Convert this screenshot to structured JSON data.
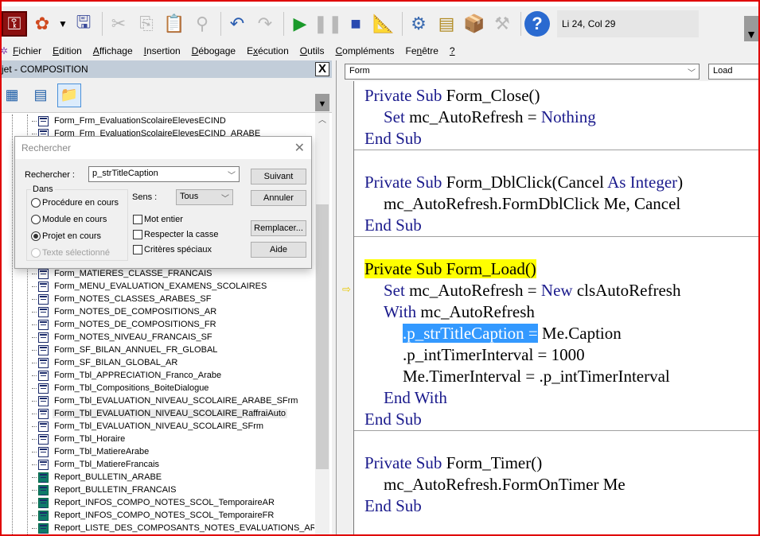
{
  "toolbar": {
    "status": "Li 24, Col 29",
    "icons": [
      "access-key-icon",
      "insert-object-icon",
      "dropdown-icon",
      "save-icon",
      "cut-icon",
      "copy-icon",
      "paste-icon",
      "find-icon",
      "undo-icon",
      "redo-icon",
      "run-icon",
      "pause-icon",
      "reset-icon",
      "design-mode-icon",
      "project-explorer-icon",
      "properties-icon",
      "object-browser-icon",
      "toolbox-icon",
      "help-icon"
    ]
  },
  "menu": [
    {
      "label": "Fichier",
      "mn": "F",
      "rest": "ichier"
    },
    {
      "label": "Edition",
      "mn": "E",
      "rest": "dition"
    },
    {
      "label": "Affichage",
      "mn": "A",
      "rest": "ffichage"
    },
    {
      "label": "Insertion",
      "mn": "I",
      "rest": "nsertion"
    },
    {
      "label": "Débogage",
      "mn": "D",
      "rest": "ébogage"
    },
    {
      "label": "Exécution",
      "mn": "x",
      "pre": "E",
      "rest": "écution"
    },
    {
      "label": "Outils",
      "mn": "O",
      "rest": "utils"
    },
    {
      "label": "Compléments",
      "mn": "C",
      "rest": "ompléments"
    },
    {
      "label": "Fenêtre",
      "mn": "n",
      "pre": "Fe",
      "rest": "être"
    },
    {
      "label": "?",
      "mn": "?",
      "rest": ""
    }
  ],
  "project": {
    "title": "jet - COMPOSITION",
    "close": "X",
    "items_top": [
      "Form_Frm_EvaluationScolaireElevesECIND",
      "Form_Frm_EvaluationScolaireElevesECIND_ARABE"
    ],
    "items": [
      {
        "name": "Form_MATIERES_CLASSE_FRANCAIS",
        "type": "form"
      },
      {
        "name": "Form_MENU_EVALUATION_EXAMENS_SCOLAIRES",
        "type": "form"
      },
      {
        "name": "Form_NOTES_CLASSES_ARABES_SF",
        "type": "form"
      },
      {
        "name": "Form_NOTES_DE_COMPOSITIONS_AR",
        "type": "form"
      },
      {
        "name": "Form_NOTES_DE_COMPOSITIONS_FR",
        "type": "form"
      },
      {
        "name": "Form_NOTES_NIVEAU_FRANCAIS_SF",
        "type": "form"
      },
      {
        "name": "Form_SF_BILAN_ANNUEL_FR_GLOBAL",
        "type": "form"
      },
      {
        "name": "Form_SF_BILAN_GLOBAL_AR",
        "type": "form"
      },
      {
        "name": "Form_Tbl_APPRECIATION_Franco_Arabe",
        "type": "form"
      },
      {
        "name": "Form_Tbl_Compositions_BoiteDialogue",
        "type": "form"
      },
      {
        "name": "Form_Tbl_EVALUATION_NIVEAU_SCOLAIRE_ARABE_SFrm",
        "type": "form"
      },
      {
        "name": "Form_Tbl_EVALUATION_NIVEAU_SCOLAIRE_RaffraiAuto",
        "type": "form",
        "selected": true
      },
      {
        "name": "Form_Tbl_EVALUATION_NIVEAU_SCOLAIRE_SFrm",
        "type": "form"
      },
      {
        "name": "Form_Tbl_Horaire",
        "type": "form"
      },
      {
        "name": "Form_Tbl_MatiereArabe",
        "type": "form"
      },
      {
        "name": "Form_Tbl_MatiereFrancais",
        "type": "form"
      },
      {
        "name": "Report_BULLETIN_ARABE",
        "type": "report"
      },
      {
        "name": "Report_BULLETIN_FRANCAIS",
        "type": "report"
      },
      {
        "name": "Report_INFOS_COMPO_NOTES_SCOL_TemporaireAR",
        "type": "report"
      },
      {
        "name": "Report_INFOS_COMPO_NOTES_SCOL_TemporaireFR",
        "type": "report"
      },
      {
        "name": "Report_LISTE_DES_COMPOSANTS_NOTES_EVALUATIONS_AR",
        "type": "report"
      }
    ]
  },
  "dialog": {
    "title": "Rechercher",
    "find_label": "Rechercher :",
    "find_value": "p_strTitleCaption",
    "group_label": "Dans",
    "scope": [
      {
        "label": "Procédure en cours",
        "checked": false,
        "disabled": false
      },
      {
        "label": "Module en cours",
        "checked": false,
        "disabled": false
      },
      {
        "label": "Projet en cours",
        "checked": true,
        "disabled": false
      },
      {
        "label": "Texte sélectionné",
        "checked": false,
        "disabled": true
      }
    ],
    "direction_label": "Sens :",
    "direction_value": "Tous",
    "options": [
      {
        "label": "Mot entier",
        "checked": false
      },
      {
        "label": "Respecter la casse",
        "checked": false
      },
      {
        "label": "Critères spéciaux",
        "checked": false
      }
    ],
    "buttons": {
      "next": "Suivant",
      "cancel": "Annuler",
      "replace": "Remplacer...",
      "help": "Aide"
    }
  },
  "code": {
    "object": "Form",
    "procedure": "Load",
    "blocks": [
      [
        [
          0,
          [
            [
              "k",
              "Private Sub"
            ],
            [
              "t",
              " Form_Close()"
            ]
          ]
        ],
        [
          1,
          [
            [
              "k",
              "Set"
            ],
            [
              "t",
              " mc_AutoRefresh = "
            ],
            [
              "k",
              "Nothing"
            ]
          ]
        ],
        [
          0,
          [
            [
              "k",
              "End Sub"
            ]
          ]
        ]
      ],
      [
        [
          0,
          [
            [
              "k",
              "Private Sub"
            ],
            [
              "t",
              " Form_DblClick(Cancel "
            ],
            [
              "k",
              "As Integer"
            ],
            [
              "t",
              ")"
            ]
          ]
        ],
        [
          1,
          [
            [
              "t",
              "mc_AutoRefresh.FormDblClick Me, Cancel"
            ]
          ]
        ],
        [
          0,
          [
            [
              "k",
              "End Sub"
            ]
          ]
        ]
      ],
      [
        [
          0,
          [
            [
              "L",
              "Private Sub Form_Load()"
            ]
          ]
        ],
        [
          1,
          [
            [
              "k",
              "Set"
            ],
            [
              "t",
              " mc_AutoRefresh = "
            ],
            [
              "k",
              "New"
            ],
            [
              "t",
              " clsAutoRefresh"
            ]
          ]
        ],
        [
          1,
          [
            [
              "k",
              "With"
            ],
            [
              "t",
              " mc_AutoRefresh"
            ]
          ]
        ],
        [
          2,
          [
            [
              "s",
              ".p_strTitleCaption ="
            ],
            [
              "t",
              " Me.Caption"
            ]
          ]
        ],
        [
          2,
          [
            [
              "t",
              ".p_intTimerInterval = 1000"
            ]
          ]
        ],
        [
          2,
          [
            [
              "t",
              "Me.TimerInterval = .p_intTimerInterval"
            ]
          ]
        ],
        [
          1,
          [
            [
              "k",
              "End With"
            ]
          ]
        ],
        [
          0,
          [
            [
              "k",
              "End Sub"
            ]
          ]
        ]
      ],
      [
        [
          0,
          [
            [
              "k",
              "Private Sub"
            ],
            [
              "t",
              " Form_Timer()"
            ]
          ]
        ],
        [
          1,
          [
            [
              "t",
              "mc_AutoRefresh.FormOnTimer Me"
            ]
          ]
        ],
        [
          0,
          [
            [
              "k",
              "End Sub"
            ]
          ]
        ]
      ]
    ],
    "colors": {
      "keyword": "#1a1a8c",
      "execution_line": "#ffff00",
      "selection": "#3399ff"
    }
  }
}
